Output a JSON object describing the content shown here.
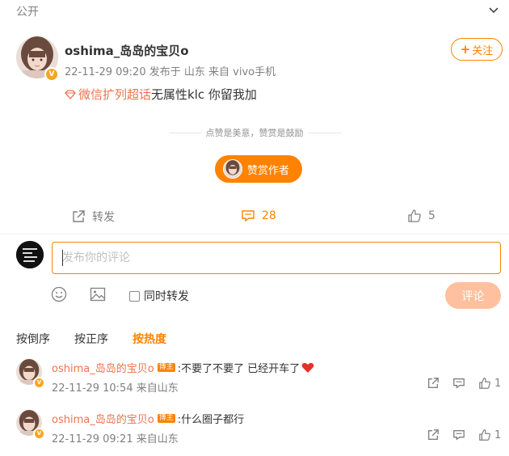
{
  "visibility": {
    "label": "公开",
    "chevron_icon": "chevron-down-icon"
  },
  "post": {
    "author": "oshima_岛岛的宝贝o",
    "date": "22-11-29 09:20",
    "location": "发布于 山东",
    "source": "来自 vivo手机",
    "follow_label": "关注",
    "follow_plus": "+",
    "supertopic_link": "微信扩列超话",
    "text": "无属性klc 你留我加",
    "reward_divider_text": "点赞是美意，赞赏是鼓励",
    "reward_button_label": "赞赏作者",
    "verified_badge": "V"
  },
  "actions": {
    "repost_label": "转发",
    "comment_count": "28",
    "like_count": "5"
  },
  "composer": {
    "placeholder": "发布你的评论",
    "repost_checkbox_label": "同时转发",
    "submit_label": "评论"
  },
  "sort_tabs": [
    {
      "label": "按倒序"
    },
    {
      "label": "按正序"
    },
    {
      "label": "按热度"
    }
  ],
  "comments": [
    {
      "author": "oshima_岛岛的宝贝o",
      "tag": "博主",
      "text": ":不要了不要了 已经开车了",
      "meta": "22-11-29 10:54 来自山东",
      "likes": "1"
    },
    {
      "author": "oshima_岛岛的宝贝o",
      "tag": "博主",
      "text": ":什么圈子都行",
      "meta": "22-11-29 09:21 来自山东",
      "likes": "1"
    }
  ],
  "colors": {
    "accent": "#ff8200",
    "name_link": "#eb7350",
    "meta_gray": "#808080",
    "submit_disabled": "#ffc09f"
  }
}
